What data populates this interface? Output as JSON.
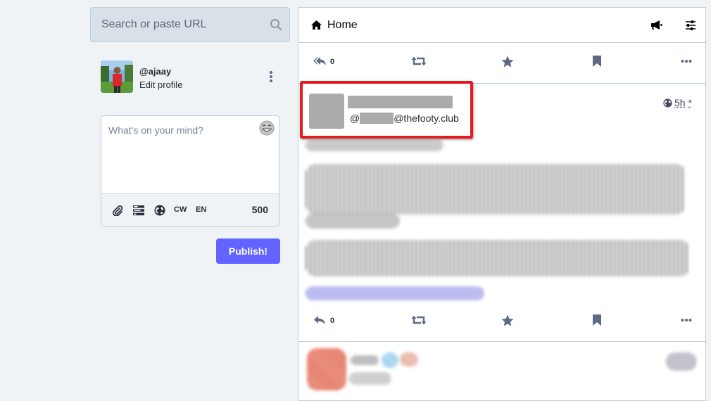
{
  "search": {
    "placeholder": "Search or paste URL"
  },
  "profile": {
    "handle": "@ajaay",
    "edit_label": "Edit profile"
  },
  "composer": {
    "placeholder": "What's on your mind?",
    "cw_label": "CW",
    "lang_label": "EN",
    "char_count": "500",
    "publish_label": "Publish!"
  },
  "column": {
    "title": "Home"
  },
  "status_top": {
    "reply_count": "0"
  },
  "status": {
    "handle_prefix": "@",
    "handle_domain": "@thefooty.club",
    "time": "5h",
    "time_suffix": "*",
    "reply_count": "0"
  },
  "colors": {
    "accent": "#6364ff",
    "highlight": "#e8181c",
    "background": "#eff3f6"
  }
}
